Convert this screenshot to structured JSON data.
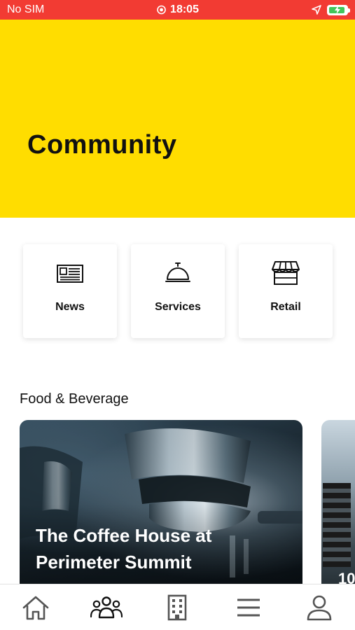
{
  "status_bar": {
    "carrier": "No SIM",
    "time": "18:05",
    "icons": [
      "record-icon",
      "location-arrow-icon",
      "battery-charging-icon"
    ]
  },
  "header": {
    "title": "Community",
    "background": "#ffdd00"
  },
  "quick_links": [
    {
      "label": "News",
      "icon": "newspaper-icon"
    },
    {
      "label": "Services",
      "icon": "service-bell-icon"
    },
    {
      "label": "Retail",
      "icon": "storefront-icon"
    }
  ],
  "section": {
    "title": "Food & Beverage"
  },
  "venues": [
    {
      "title": "The Coffee House at Perimeter Summit"
    },
    {
      "title_partial": "10"
    }
  ],
  "tab_bar": {
    "tabs": [
      {
        "name": "home",
        "icon": "home-icon"
      },
      {
        "name": "community",
        "icon": "people-icon",
        "active": true
      },
      {
        "name": "building",
        "icon": "building-icon"
      },
      {
        "name": "menu",
        "icon": "hamburger-menu-icon"
      },
      {
        "name": "profile",
        "icon": "user-icon"
      }
    ]
  },
  "colors": {
    "status_bar": "#f23b33",
    "accent": "#ffdd00",
    "text": "#111111",
    "tab_inactive": "#555555"
  }
}
